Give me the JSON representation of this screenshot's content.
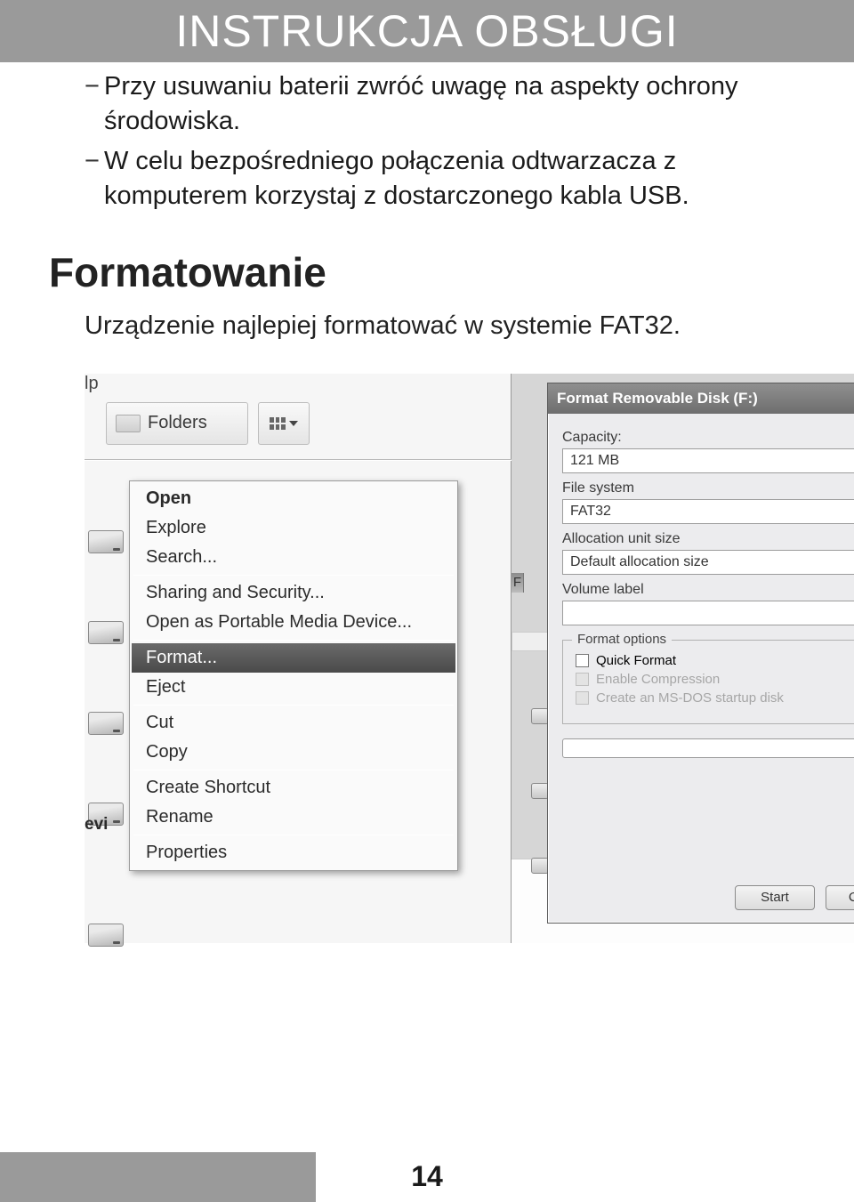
{
  "header": {
    "title": "INSTRUKCJA OBSŁUGI"
  },
  "bullets": [
    "Przy usuwaniu baterii zwróć uwagę na aspekty ochrony środowiska.",
    "W celu bezpośredniego połączenia odtwarzacza z komputerem korzystaj z dostarczonego kabla USB."
  ],
  "section": {
    "heading": "Formatowanie",
    "sub": "Urządzenie najlepiej formatować w systemie FAT32."
  },
  "left_panel": {
    "lp_label": "lp",
    "folders_label": "Folders",
    "evi_label": "evi"
  },
  "context_menu": {
    "items": [
      {
        "label": "Open",
        "bold": true
      },
      {
        "label": "Explore"
      },
      {
        "label": "Search..."
      },
      {
        "sep": true
      },
      {
        "label": "Sharing and Security..."
      },
      {
        "label": "Open as Portable Media Device..."
      },
      {
        "sep": true
      },
      {
        "label": "Format...",
        "highlight": true
      },
      {
        "label": "Eject"
      },
      {
        "sep": true
      },
      {
        "label": "Cut"
      },
      {
        "label": "Copy"
      },
      {
        "sep": true
      },
      {
        "label": "Create Shortcut"
      },
      {
        "label": "Rename"
      },
      {
        "sep": true
      },
      {
        "label": "Properties"
      }
    ]
  },
  "right_panel": {
    "f_label": "F"
  },
  "dialog": {
    "title": "Format Removable Disk (F:)",
    "help_btn": "?",
    "close_btn": "✕",
    "capacity_label": "Capacity:",
    "capacity_value": "121 MB",
    "filesystem_label": "File system",
    "filesystem_value": "FAT32",
    "alloc_label": "Allocation unit size",
    "alloc_value": "Default allocation size",
    "volume_label": "Volume label",
    "volume_value": "",
    "format_options_legend": "Format options",
    "quick_format": "Quick Format",
    "enable_compression": "Enable Compression",
    "msdos": "Create an MS-DOS startup disk",
    "start_btn": "Start",
    "close_btn2": "Close"
  },
  "page_number": "14"
}
